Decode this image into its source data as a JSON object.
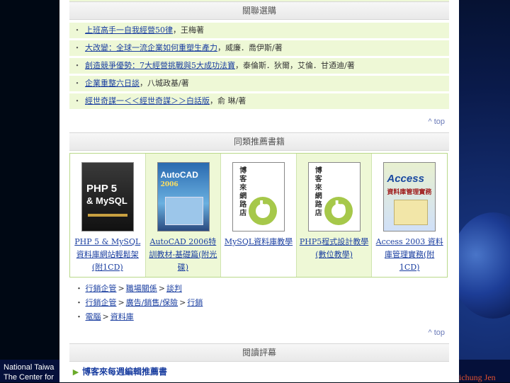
{
  "footer": {
    "left_line1": "National Taiwa",
    "left_line2": "The Center for",
    "right_author": "ichung Jen"
  },
  "page": {
    "related_heading": "關聯選購",
    "related_items": [
      {
        "link": "上班高手一自我經營50律",
        "rest": "，王梅著"
      },
      {
        "link": "大改變：全球一流企業如何重塑生產力",
        "rest": "，威廉．喬伊斯/著"
      },
      {
        "link": "創造競爭優勢：7大經營挑戰與5大成功法寶",
        "rest": "，泰倫斯．狄爾，艾倫．甘迺迪/著"
      },
      {
        "link": "企業重整六日談",
        "rest": "，八城政基/著"
      },
      {
        "link": "經世奇謀一＜＜經世奇謀＞＞白話版",
        "rest": "，俞 琳/著"
      }
    ],
    "top_label": "^ top",
    "similar_heading": "同類推薦書籍",
    "books": [
      {
        "cover": "php",
        "cover_text1": "PHP 5",
        "cover_text2": "& MySQL",
        "title": "PHP 5 & MySQL資料庫網站輕鬆架(附1CD)"
      },
      {
        "cover": "acad",
        "cover_text1": "AutoCAD",
        "cover_text2": "2006",
        "title": "AutoCAD 2006特訓教材-基礎篇(附光碟)"
      },
      {
        "cover": "blog",
        "cover_text1": "博客來網路店",
        "cover_text2": "b",
        "title": "MySQL資料庫教學"
      },
      {
        "cover": "blog",
        "cover_text1": "博客來網路店",
        "cover_text2": "b",
        "title": "PHP5程式設計教學(數位教學)"
      },
      {
        "cover": "access",
        "cover_text1": "Access",
        "cover_text2": "資料庫管理實務",
        "title": "Access 2003 資料庫管理實務(附1CD)"
      }
    ],
    "categories": [
      [
        "行銷企管",
        "職場關係",
        "談判"
      ],
      [
        "行銷企管",
        "廣告/銷售/保險",
        "行銷"
      ],
      [
        "電腦",
        "資料庫"
      ]
    ],
    "category_sep": ">",
    "bullet": "・",
    "review_heading": "閱讀評幕",
    "editor_pick": "博客來每週編輯推薦書"
  }
}
